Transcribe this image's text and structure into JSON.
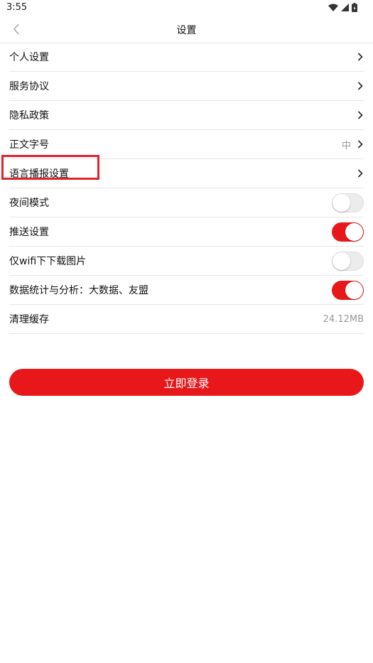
{
  "status_bar": {
    "time": "3:55"
  },
  "header": {
    "title": "设置"
  },
  "settings": {
    "personal": "个人设置",
    "service": "服务协议",
    "privacy": "隐私政策",
    "font_size_label": "正文字号",
    "font_size_value": "中",
    "voice": "语言播报设置",
    "night_mode": {
      "label": "夜间模式",
      "on": false
    },
    "push": {
      "label": "推送设置",
      "on": true
    },
    "wifi_images": {
      "label": "仅wifi下下载图片",
      "on": false
    },
    "analytics": {
      "label": "数据统计与分析：大数据、友盟",
      "on": true
    },
    "cache_label": "清理缓存",
    "cache_value": "24.12MB"
  },
  "actions": {
    "login": "立即登录"
  },
  "colors": {
    "accent": "#e8171a",
    "highlight": "#e0242f"
  }
}
